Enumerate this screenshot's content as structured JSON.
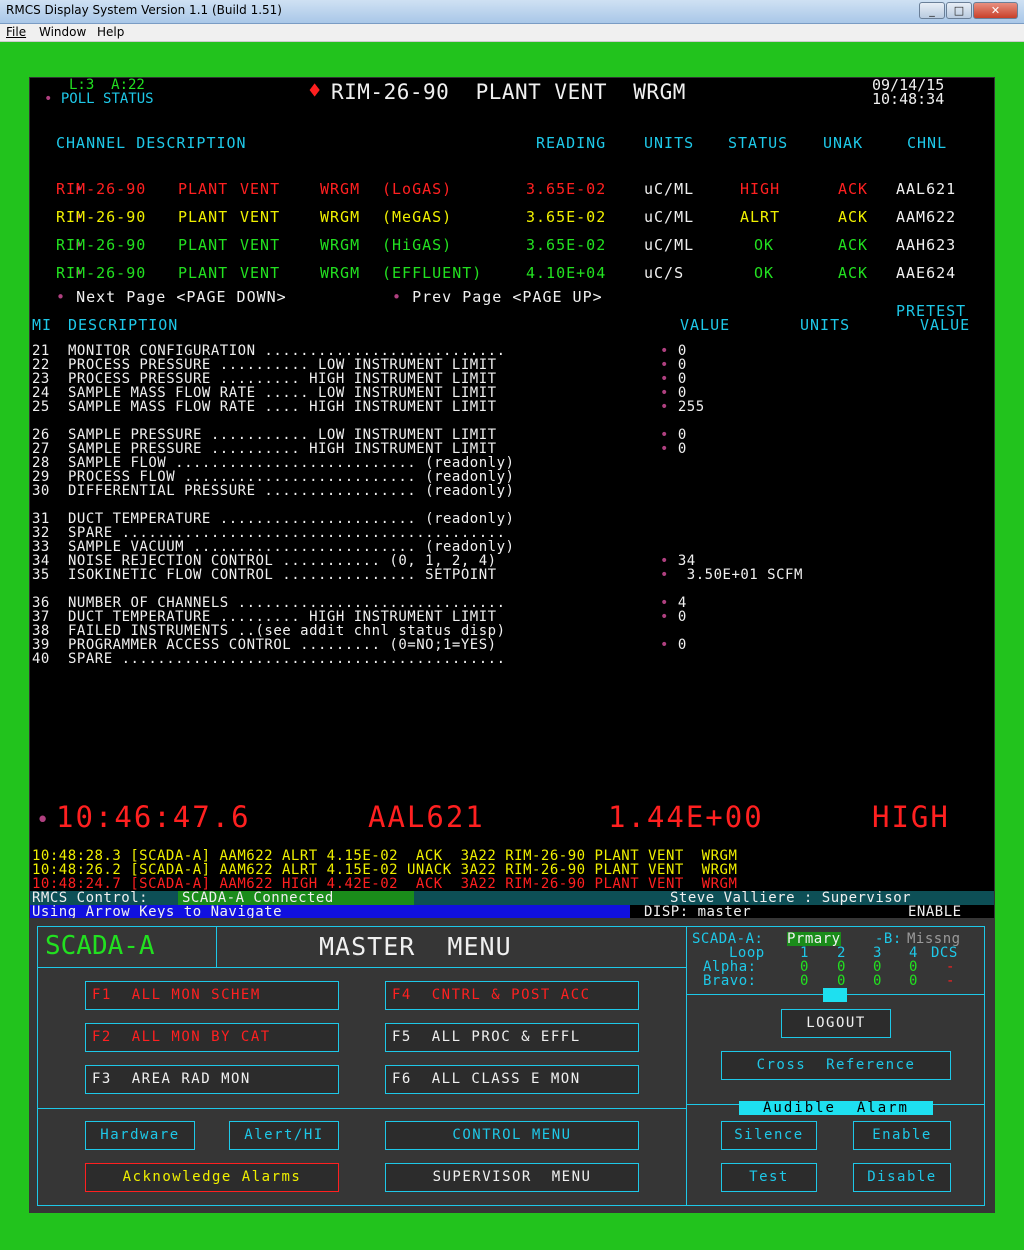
{
  "window": {
    "title": "RMCS Display System    Version 1.1    (Build 1.51)",
    "min": "_",
    "max": "□",
    "close": "✕"
  },
  "menu": [
    "File",
    "Window",
    "Help"
  ],
  "header": {
    "loop": "L:3  A:22",
    "poll": "POLL STATUS",
    "diamond": "♦",
    "title": "RIM-26-90  PLANT VENT  WRGM",
    "date": "09/14/15",
    "time": "10:48:34"
  },
  "channels": {
    "headers": {
      "desc": "CHANNEL DESCRIPTION",
      "reading": "READING",
      "units": "UNITS",
      "status": "STATUS",
      "unak": "UNAK",
      "chnl": "CHNL"
    },
    "rows": [
      {
        "d1": "RIM-26-90",
        "d2": "PLANT",
        "d3": "VENT",
        "d4": "WRGM",
        "d5": "(LoGAS)",
        "reading": "3.65E-02",
        "units": "uC/ML",
        "status": "HIGH",
        "unak": "ACK",
        "chnl": "AAL621"
      },
      {
        "d1": "RIM-26-90",
        "d2": "PLANT",
        "d3": "VENT",
        "d4": "WRGM",
        "d5": "(MeGAS)",
        "reading": "3.65E-02",
        "units": "uC/ML",
        "status": "ALRT",
        "unak": "ACK",
        "chnl": "AAM622"
      },
      {
        "d1": "RIM-26-90",
        "d2": "PLANT",
        "d3": "VENT",
        "d4": "WRGM",
        "d5": "(HiGAS)",
        "reading": "3.65E-02",
        "units": "uC/ML",
        "status": "OK",
        "unak": "ACK",
        "chnl": "AAH623"
      },
      {
        "d1": "RIM-26-90",
        "d2": "PLANT",
        "d3": "VENT",
        "d4": "WRGM",
        "d5": "(EFFLUENT)",
        "reading": "4.10E+04",
        "units": "uC/S",
        "status": "OK",
        "unak": "ACK",
        "chnl": "AAE624"
      }
    ],
    "colors": {
      "high": "#ff2020",
      "alert": "#f0f000",
      "ok": "#22e020",
      "ack": "#ff2020"
    }
  },
  "paging": {
    "next": "Next Page <PAGE DOWN>",
    "prev": "Prev Page <PAGE UP>"
  },
  "mi_table": {
    "headers": {
      "mi": "MI",
      "desc": "DESCRIPTION",
      "value": "VALUE",
      "units": "UNITS",
      "pretest1": "PRETEST",
      "pretest2": "VALUE"
    },
    "rows": [
      {
        "n": "21",
        "d": "MONITOR CONFIGURATION ........................... ",
        "v": "• 0"
      },
      {
        "n": "22",
        "d": "PROCESS PRESSURE .......... LOW INSTRUMENT LIMIT ",
        "v": "• 0"
      },
      {
        "n": "23",
        "d": "PROCESS PRESSURE ......... HIGH INSTRUMENT LIMIT ",
        "v": "• 0"
      },
      {
        "n": "24",
        "d": "SAMPLE MASS FLOW RATE ..... LOW INSTRUMENT LIMIT ",
        "v": "• 0"
      },
      {
        "n": "25",
        "d": "SAMPLE MASS FLOW RATE .... HIGH INSTRUMENT LIMIT ",
        "v": "• 255"
      },
      {
        "n": "",
        "d": "",
        "v": ""
      },
      {
        "n": "26",
        "d": "SAMPLE PRESSURE ........... LOW INSTRUMENT LIMIT ",
        "v": "• 0"
      },
      {
        "n": "27",
        "d": "SAMPLE PRESSURE .......... HIGH INSTRUMENT LIMIT ",
        "v": "• 0"
      },
      {
        "n": "28",
        "d": "SAMPLE FLOW ........................... (readonly)",
        "v": ""
      },
      {
        "n": "29",
        "d": "PROCESS FLOW .......................... (readonly)",
        "v": ""
      },
      {
        "n": "30",
        "d": "DIFFERENTIAL PRESSURE ................. (readonly)",
        "v": ""
      },
      {
        "n": "",
        "d": "",
        "v": ""
      },
      {
        "n": "31",
        "d": "DUCT TEMPERATURE ...................... (readonly)",
        "v": ""
      },
      {
        "n": "32",
        "d": "SPARE ...........................................",
        "v": ""
      },
      {
        "n": "33",
        "d": "SAMPLE VACUUM ......................... (readonly)",
        "v": ""
      },
      {
        "n": "34",
        "d": "NOISE REJECTION CONTROL ........... (0, 1, 2, 4) ",
        "v": "• 34"
      },
      {
        "n": "35",
        "d": "ISOKINETIC FLOW CONTROL ............... SETPOINT ",
        "v": "•  3.50E+01 SCFM"
      },
      {
        "n": "",
        "d": "",
        "v": ""
      },
      {
        "n": "36",
        "d": "NUMBER OF CHANNELS .............................. ",
        "v": "• 4"
      },
      {
        "n": "37",
        "d": "DUCT TEMPERATURE ......... HIGH INSTRUMENT LIMIT ",
        "v": "• 0"
      },
      {
        "n": "38",
        "d": "FAILED INSTRUMENTS ..(see addit chnl status disp)",
        "v": ""
      },
      {
        "n": "39",
        "d": "PROGRAMMER ACCESS CONTROL ......... (0=NO;1=YES) ",
        "v": "• 0"
      },
      {
        "n": "40",
        "d": "SPARE ...........................................",
        "v": ""
      }
    ]
  },
  "current_alarm": {
    "time": "10:46:47.6",
    "chnl": "AAL621",
    "reading": "1.44E+00",
    "status": "HIGH"
  },
  "events": [
    {
      "text": "10:48:28.3 [SCADA-A] AAM622 ALRT 4.15E-02  ACK  3A22 RIM-26-90 PLANT VENT  WRGM",
      "color": "#f0f000"
    },
    {
      "text": "10:48:26.2 [SCADA-A] AAM622 ALRT 4.15E-02 UNACK 3A22 RIM-26-90 PLANT VENT  WRGM",
      "color": "#f0f000"
    },
    {
      "text": "10:48:24.7 [SCADA-A] AAM622 HIGH 4.42E-02  ACK  3A22 RIM-26-90 PLANT VENT  WRGM",
      "color": "#ff2020"
    }
  ],
  "statusbar": {
    "control_label": "RMCS Control:",
    "control_value": "SCADA-A Connected",
    "user": "Steve Valliere : Supervisor",
    "hint": "Using Arrow Keys to Navigate",
    "disp": "DISP: master",
    "enable": "ENABLE"
  },
  "panel": {
    "system": "SCADA-A",
    "title": "MASTER  MENU",
    "fkeys": [
      {
        "label": "F1  ALL MON SCHEM",
        "color": "#ff2020"
      },
      {
        "label": "F4  CNTRL & POST ACC",
        "color": "#ff2020"
      },
      {
        "label": "F2  ALL MON BY CAT",
        "color": "#ff2020"
      },
      {
        "label": "F5  ALL PROC & EFFL",
        "color": "#f0f0f0"
      },
      {
        "label": "F3  AREA RAD MON",
        "color": "#f0f0f0"
      },
      {
        "label": "F6  ALL CLASS E MON",
        "color": "#f0f0f0"
      }
    ],
    "hardware": "Hardware",
    "alert_hi": "Alert/HI",
    "control_menu": "CONTROL MENU",
    "ack_alarms": "Acknowledge Alarms",
    "supervisor_menu": "SUPERVISOR  MENU",
    "scada_status": {
      "a_label": "SCADA-A:",
      "a_value": "Prmary",
      "b_label": "-B:",
      "b_value": "Missng",
      "loop_label": "Loop",
      "loops": [
        "1",
        "2",
        "3",
        "4"
      ],
      "dcs": "DCS",
      "alpha_label": "Alpha:",
      "bravo_label": "Bravo:",
      "alpha_vals": [
        "0",
        "0",
        "0",
        "0",
        "-"
      ],
      "bravo_vals": [
        "0",
        "0",
        "0",
        "0",
        "-"
      ]
    },
    "logout": "LOGOUT",
    "cross_ref": "Cross  Reference",
    "audible": "Audible  Alarm",
    "silence": "Silence",
    "enable": "Enable",
    "test": "Test",
    "disable": "Disable"
  }
}
